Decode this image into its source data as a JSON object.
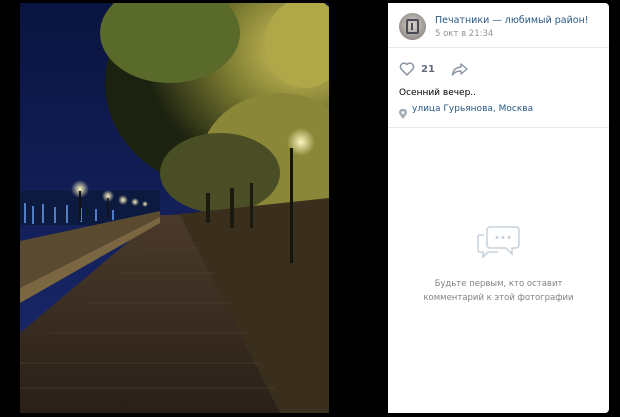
{
  "post": {
    "group_name": "Печатники — любимый район!",
    "date": "5 окт в 21:34",
    "likes": "21",
    "caption": "Осенний вечер..",
    "location": "улица Гурьянова, Москва"
  },
  "comments": {
    "empty_line1": "Будьте первым, кто оставит",
    "empty_line2": "комментарий к этой фотографии"
  },
  "icons": {
    "like": "heart-icon",
    "share": "share-arrow-icon",
    "location": "map-pin-icon",
    "comments": "chat-bubble-icon"
  },
  "colors": {
    "link_blue": "#2a5885",
    "muted_gray": "#939393",
    "icon_gray": "#a2adb8",
    "divider": "#e7e8ec"
  }
}
